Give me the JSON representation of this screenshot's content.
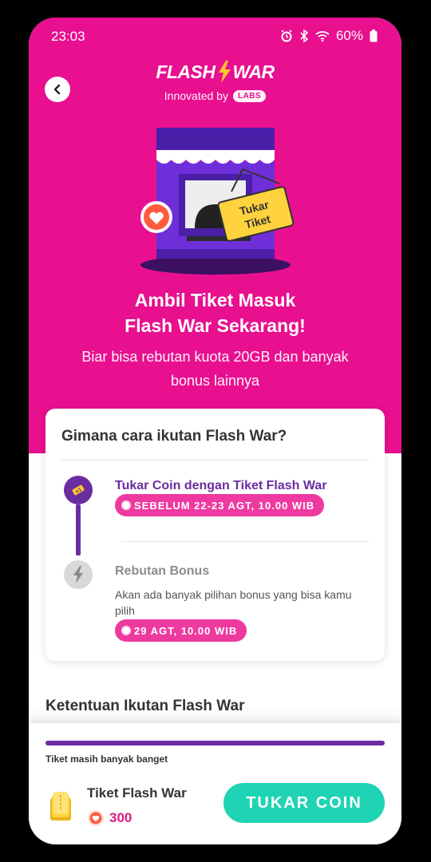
{
  "status_bar": {
    "time": "23:03",
    "battery": "60%"
  },
  "brand": {
    "logo_left": "FLASH",
    "logo_right": "WAR",
    "innovated_by": "Innovated by",
    "labs_badge": "LABS"
  },
  "illustration": {
    "sign_line1": "Tukar",
    "sign_line2": "Tiket"
  },
  "headline": {
    "title": "Ambil Tiket Masuk\nFlash War Sekarang!",
    "subtitle": "Biar bisa rebutan kuota 20GB dan banyak\nbonus lainnya"
  },
  "how_card": {
    "title": "Gimana cara ikutan Flash War?",
    "steps": [
      {
        "title": "Tukar Coin dengan Tiket Flash War",
        "badge": "SEBELUM 22-23 AGT, 10.00 WIB"
      },
      {
        "title": "Rebutan Bonus",
        "desc": "Akan ada banyak pilihan bonus yang bisa kamu pilih",
        "badge": "29 AGT, 10.00 WIB"
      }
    ]
  },
  "rules": {
    "heading": "Ketentuan Ikutan Flash War"
  },
  "bottom": {
    "progress_fraction": 1.0,
    "progress_label": "Tiket masih banyak banget",
    "ticket_name": "Tiket Flash War",
    "ticket_price": "300",
    "cta_label": "TUKAR COIN"
  },
  "colors": {
    "primary": "#e8108f",
    "accent_purple": "#6b2ca0",
    "cta": "#1fd4b4",
    "pill": "#ee3aa0"
  }
}
